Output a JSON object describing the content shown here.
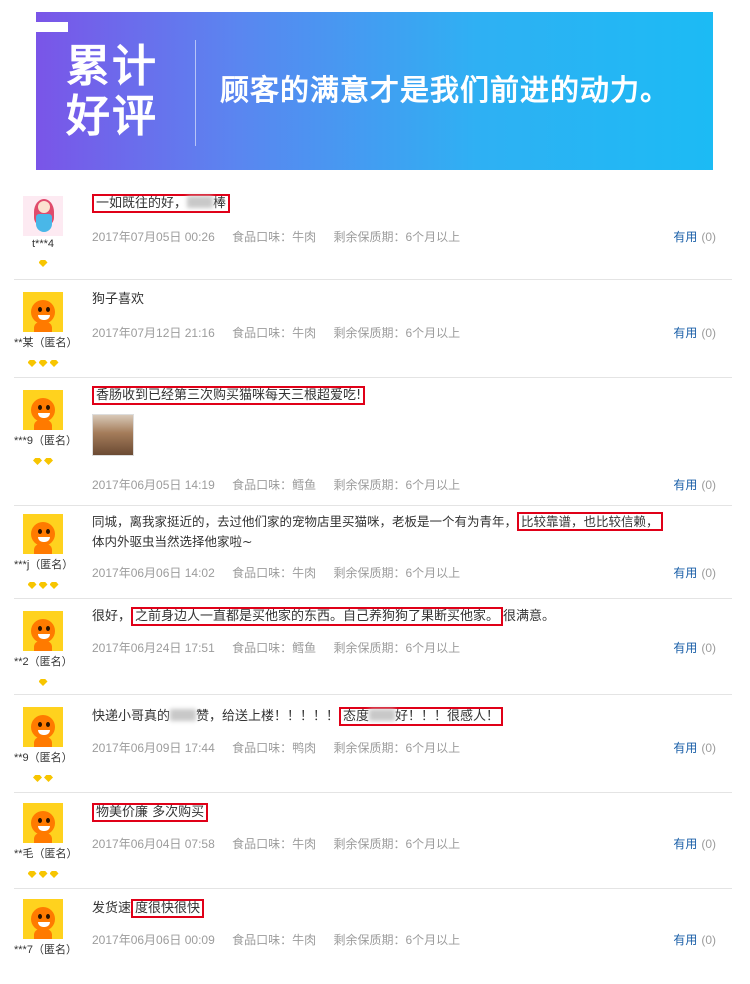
{
  "banner": {
    "title_line1": "累计",
    "title_line2": "好评",
    "slogan": "顾客的满意才是我们前进的动力。"
  },
  "reviews": [
    {
      "user": "t***4",
      "level": 1,
      "text_parts": [
        "一如既往的好，",
        "棒"
      ],
      "date": "2017年07月05日 00:26",
      "attr1": "食品口味：牛肉",
      "attr2": "剩余保质期：6个月以上",
      "useful_label": "有用",
      "useful_count": "(0)"
    },
    {
      "user": "**某（匿名）",
      "level": 3,
      "text": "狗子喜欢",
      "date": "2017年07月12日 21:16",
      "attr1": "食品口味：牛肉",
      "attr2": "剩余保质期：6个月以上",
      "useful_label": "有用",
      "useful_count": "(0)"
    },
    {
      "user": "***9（匿名）",
      "level": 2,
      "text": "香肠收到已经第三次购买猫咪每天三根超爱吃!",
      "date": "2017年06月05日 14:19",
      "attr1": "食品口味：鳕鱼",
      "attr2": "剩余保质期：6个月以上",
      "useful_label": "有用",
      "useful_count": "(0)"
    },
    {
      "user": "***j（匿名）",
      "level": 3,
      "text_parts": [
        "同城，离我家挺近的，去过他们家的宠物店里买猫咪，老板是一个有为青年，",
        "比较靠谱，也比较信赖，",
        "体内外驱虫当然选择他家啦~"
      ],
      "date": "2017年06月06日 14:02",
      "attr1": "食品口味：牛肉",
      "attr2": "剩余保质期：6个月以上",
      "useful_label": "有用",
      "useful_count": "(0)"
    },
    {
      "user": "**2（匿名）",
      "level": 1,
      "text_parts": [
        "很好，",
        "之前身边人一直都是买他家的东西。自己养狗狗了果断买他家。",
        "很满意。"
      ],
      "date": "2017年06月24日 17:51",
      "attr1": "食品口味：鳕鱼",
      "attr2": "剩余保质期：6个月以上",
      "useful_label": "有用",
      "useful_count": "(0)"
    },
    {
      "user": "**9（匿名）",
      "level": 2,
      "text_parts": [
        "快递小哥真的",
        "赞，给送上楼！！！！！",
        "态度",
        "好！！！很感人！"
      ],
      "date": "2017年06月09日 17:44",
      "attr1": "食品口味：鸭肉",
      "attr2": "剩余保质期：6个月以上",
      "useful_label": "有用",
      "useful_count": "(0)"
    },
    {
      "user": "**毛（匿名）",
      "level": 3,
      "text": "物美价廉 多次购买",
      "date": "2017年06月04日 07:58",
      "attr1": "食品口味：牛肉",
      "attr2": "剩余保质期：6个月以上",
      "useful_label": "有用",
      "useful_count": "(0)"
    },
    {
      "user": "***7（匿名）",
      "level": 0,
      "text_parts": [
        "发货速",
        "度很快很快"
      ],
      "date": "2017年06月06日 00:09",
      "attr1": "食品口味：牛肉",
      "attr2": "剩余保质期：6个月以上",
      "useful_label": "有用",
      "useful_count": "(0)"
    }
  ]
}
